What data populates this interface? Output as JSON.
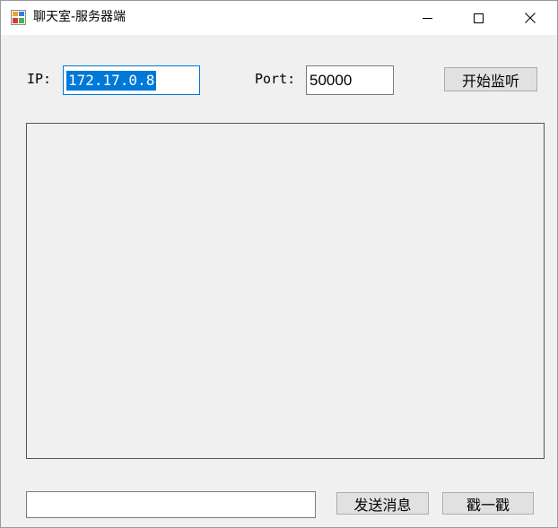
{
  "window": {
    "title": "聊天室-服务器端",
    "icon": "winforms-app-icon",
    "controls": [
      "minimize-icon",
      "maximize-icon",
      "close-icon"
    ]
  },
  "connection": {
    "ip_label": "IP:",
    "ip_value": "172.17.0.8",
    "port_label": "Port:",
    "port_value": "50000",
    "listen_button": "开始监听"
  },
  "log": {
    "content": ""
  },
  "compose": {
    "message_value": "",
    "send_button": "发送消息",
    "poke_button": "戳一戳"
  },
  "colors": {
    "selection": "#0078d7",
    "window_bg": "#f0f0f0",
    "button_bg": "#e1e1e1"
  }
}
